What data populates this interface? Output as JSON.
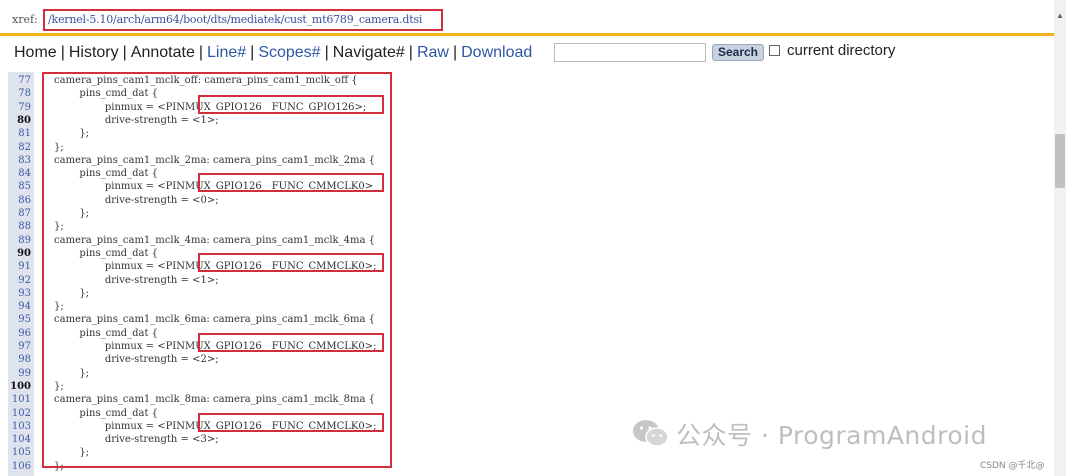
{
  "xref": {
    "label": "xref:",
    "path": "/kernel-5.10/arch/arm64/boot/dts/mediatek/cust_mt6789_camera.dtsi"
  },
  "nav": {
    "items": [
      {
        "label": "Home",
        "style": "plain"
      },
      {
        "label": "History",
        "style": "plain"
      },
      {
        "label": "Annotate",
        "style": "plain"
      },
      {
        "label": "Line#",
        "style": "link"
      },
      {
        "label": "Scopes#",
        "style": "link"
      },
      {
        "label": "Navigate#",
        "style": "plain"
      },
      {
        "label": "Raw",
        "style": "link"
      },
      {
        "label": "Download",
        "style": "link"
      }
    ],
    "separator": "|",
    "search_value": "",
    "search_button": "Search",
    "current_directory_label": "current directory",
    "current_directory_checked": false
  },
  "code": {
    "lines": [
      {
        "n": "77",
        "text": "camera_pins_cam1_mclk_off: camera_pins_cam1_mclk_off {"
      },
      {
        "n": "78",
        "text": "        pins_cmd_dat {"
      },
      {
        "n": "79",
        "text": "                pinmux = <PINMUX_GPIO126__FUNC_GPIO126>;"
      },
      {
        "n": "80",
        "text": "                drive-strength = <1>;",
        "bold": true
      },
      {
        "n": "81",
        "text": "        };"
      },
      {
        "n": "82",
        "text": "};"
      },
      {
        "n": "83",
        "text": "camera_pins_cam1_mclk_2ma: camera_pins_cam1_mclk_2ma {"
      },
      {
        "n": "84",
        "text": "        pins_cmd_dat {"
      },
      {
        "n": "85",
        "text": "                pinmux = <PINMUX_GPIO126__FUNC_CMMCLK0>"
      },
      {
        "n": "86",
        "text": "                drive-strength = <0>;"
      },
      {
        "n": "87",
        "text": "        };"
      },
      {
        "n": "88",
        "text": "};"
      },
      {
        "n": "89",
        "text": "camera_pins_cam1_mclk_4ma: camera_pins_cam1_mclk_4ma {"
      },
      {
        "n": "90",
        "text": "        pins_cmd_dat {",
        "bold": true
      },
      {
        "n": "91",
        "text": "                pinmux = <PINMUX_GPIO126__FUNC_CMMCLK0>;"
      },
      {
        "n": "92",
        "text": "                drive-strength = <1>;"
      },
      {
        "n": "93",
        "text": "        };"
      },
      {
        "n": "94",
        "text": "};"
      },
      {
        "n": "95",
        "text": "camera_pins_cam1_mclk_6ma: camera_pins_cam1_mclk_6ma {"
      },
      {
        "n": "96",
        "text": "        pins_cmd_dat {"
      },
      {
        "n": "97",
        "text": "                pinmux = <PINMUX_GPIO126__FUNC_CMMCLK0>;"
      },
      {
        "n": "98",
        "text": "                drive-strength = <2>;"
      },
      {
        "n": "99",
        "text": "        };"
      },
      {
        "n": "100",
        "text": "};",
        "bold": true
      },
      {
        "n": "101",
        "text": "camera_pins_cam1_mclk_8ma: camera_pins_cam1_mclk_8ma {"
      },
      {
        "n": "102",
        "text": "        pins_cmd_dat {"
      },
      {
        "n": "103",
        "text": "                pinmux = <PINMUX_GPIO126__FUNC_CMMCLK0>;"
      },
      {
        "n": "104",
        "text": "                drive-strength = <3>;"
      },
      {
        "n": "105",
        "text": "        };"
      },
      {
        "n": "106",
        "text": "};"
      }
    ]
  },
  "watermark": {
    "icon": "wechat-icon",
    "text": "公众号 · ProgramAndroid",
    "credit": "CSDN @千北@"
  },
  "colors": {
    "highlight_box": "#d1303a",
    "rule": "#f2b51c",
    "link": "#2d57a3"
  }
}
